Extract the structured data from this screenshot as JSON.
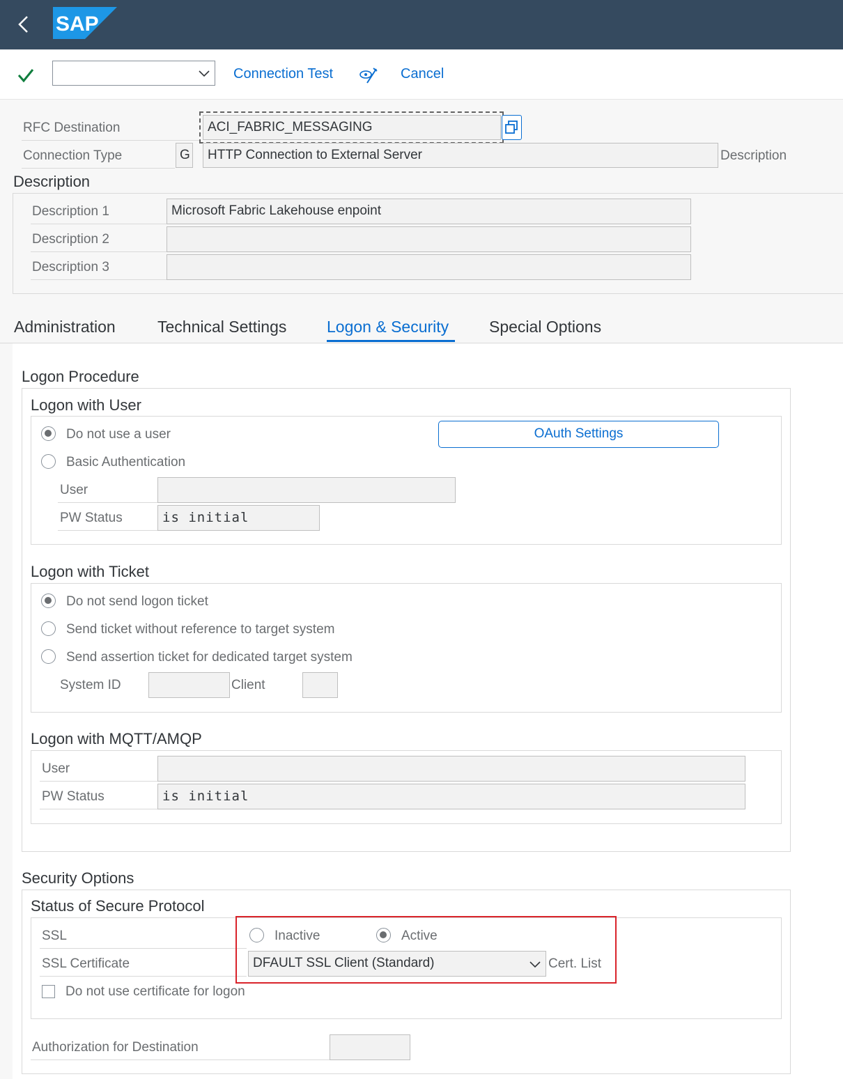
{
  "shell": {
    "back_icon": "chevron-left-icon",
    "logo_text": "SAP",
    "colors": {
      "shell_bg": "#354a5f",
      "logo_blue": "#1d97e6"
    }
  },
  "toolbar": {
    "command_value": "",
    "connection_test": "Connection Test",
    "cancel": "Cancel",
    "check_icon": "check-icon",
    "edit_icon": "display-change-icon"
  },
  "header": {
    "rfc_destination_label": "RFC Destination",
    "rfc_destination_value": "ACI_FABRIC_MESSAGING",
    "connection_type_label": "Connection Type",
    "connection_type_code": "G",
    "connection_type_text": "HTTP Connection to External Server",
    "description_suffix": "Description"
  },
  "description": {
    "title": "Description",
    "rows": [
      {
        "label": "Description 1",
        "value": "Microsoft Fabric Lakehouse enpoint"
      },
      {
        "label": "Description 2",
        "value": ""
      },
      {
        "label": "Description 3",
        "value": ""
      }
    ]
  },
  "tabs": [
    {
      "label": "Administration"
    },
    {
      "label": "Technical Settings"
    },
    {
      "label": "Logon & Security",
      "selected": true
    },
    {
      "label": "Special Options"
    }
  ],
  "logon": {
    "title": "Logon Procedure",
    "with_user": {
      "title": "Logon with User",
      "opt_no_user": "Do not use a user",
      "opt_basic": "Basic Authentication",
      "oauth_button": "OAuth Settings",
      "user_label": "User",
      "user_value": "",
      "pw_label": "PW Status",
      "pw_value": "is initial"
    },
    "with_ticket": {
      "title": "Logon with Ticket",
      "opt1": "Do not send logon ticket",
      "opt2": "Send ticket without reference to target system",
      "opt3": "Send assertion ticket for dedicated target system",
      "sysid_label": "System ID",
      "client_label": "Client"
    },
    "mqtt": {
      "title": "Logon with MQTT/AMQP",
      "user_label": "User",
      "user_value": "",
      "pw_label": "PW Status",
      "pw_value": "is initial"
    }
  },
  "security": {
    "title": "Security Options",
    "protocol_title": "Status of Secure Protocol",
    "ssl_label": "SSL",
    "inactive": "Inactive",
    "active": "Active",
    "cert_label": "SSL Certificate",
    "cert_value": "DFAULT SSL Client (Standard)",
    "cert_list": "Cert. List",
    "no_cert": "Do not use certificate for logon",
    "auth_label": "Authorization for Destination",
    "highlight_color": "#d9232a"
  }
}
